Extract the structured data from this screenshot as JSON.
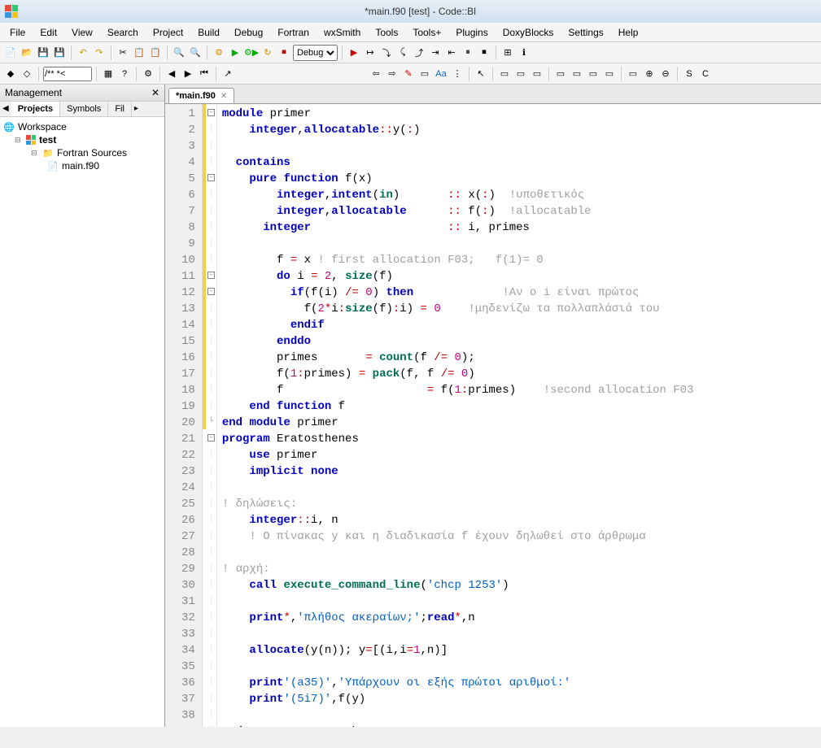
{
  "title": "*main.f90 [test] - Code::Bl",
  "menu": [
    "File",
    "Edit",
    "View",
    "Search",
    "Project",
    "Build",
    "Debug",
    "Fortran",
    "wxSmith",
    "Tools",
    "Tools+",
    "Plugins",
    "DoxyBlocks",
    "Settings",
    "Help"
  ],
  "buildTarget": "Debug",
  "panel": {
    "title": "Management",
    "tabs": [
      "Projects",
      "Symbols",
      "Fil"
    ],
    "arrow": "▸"
  },
  "tree": {
    "ws": "Workspace",
    "proj": "test",
    "folder": "Fortran Sources",
    "file": "main.f90",
    "glyphWs": "🌐",
    "glyphProj": "◱",
    "glyphFolder": "📁",
    "glyphFile": "📄"
  },
  "editorTab": "*main.f90",
  "code": {
    "lineCount": 39
  }
}
